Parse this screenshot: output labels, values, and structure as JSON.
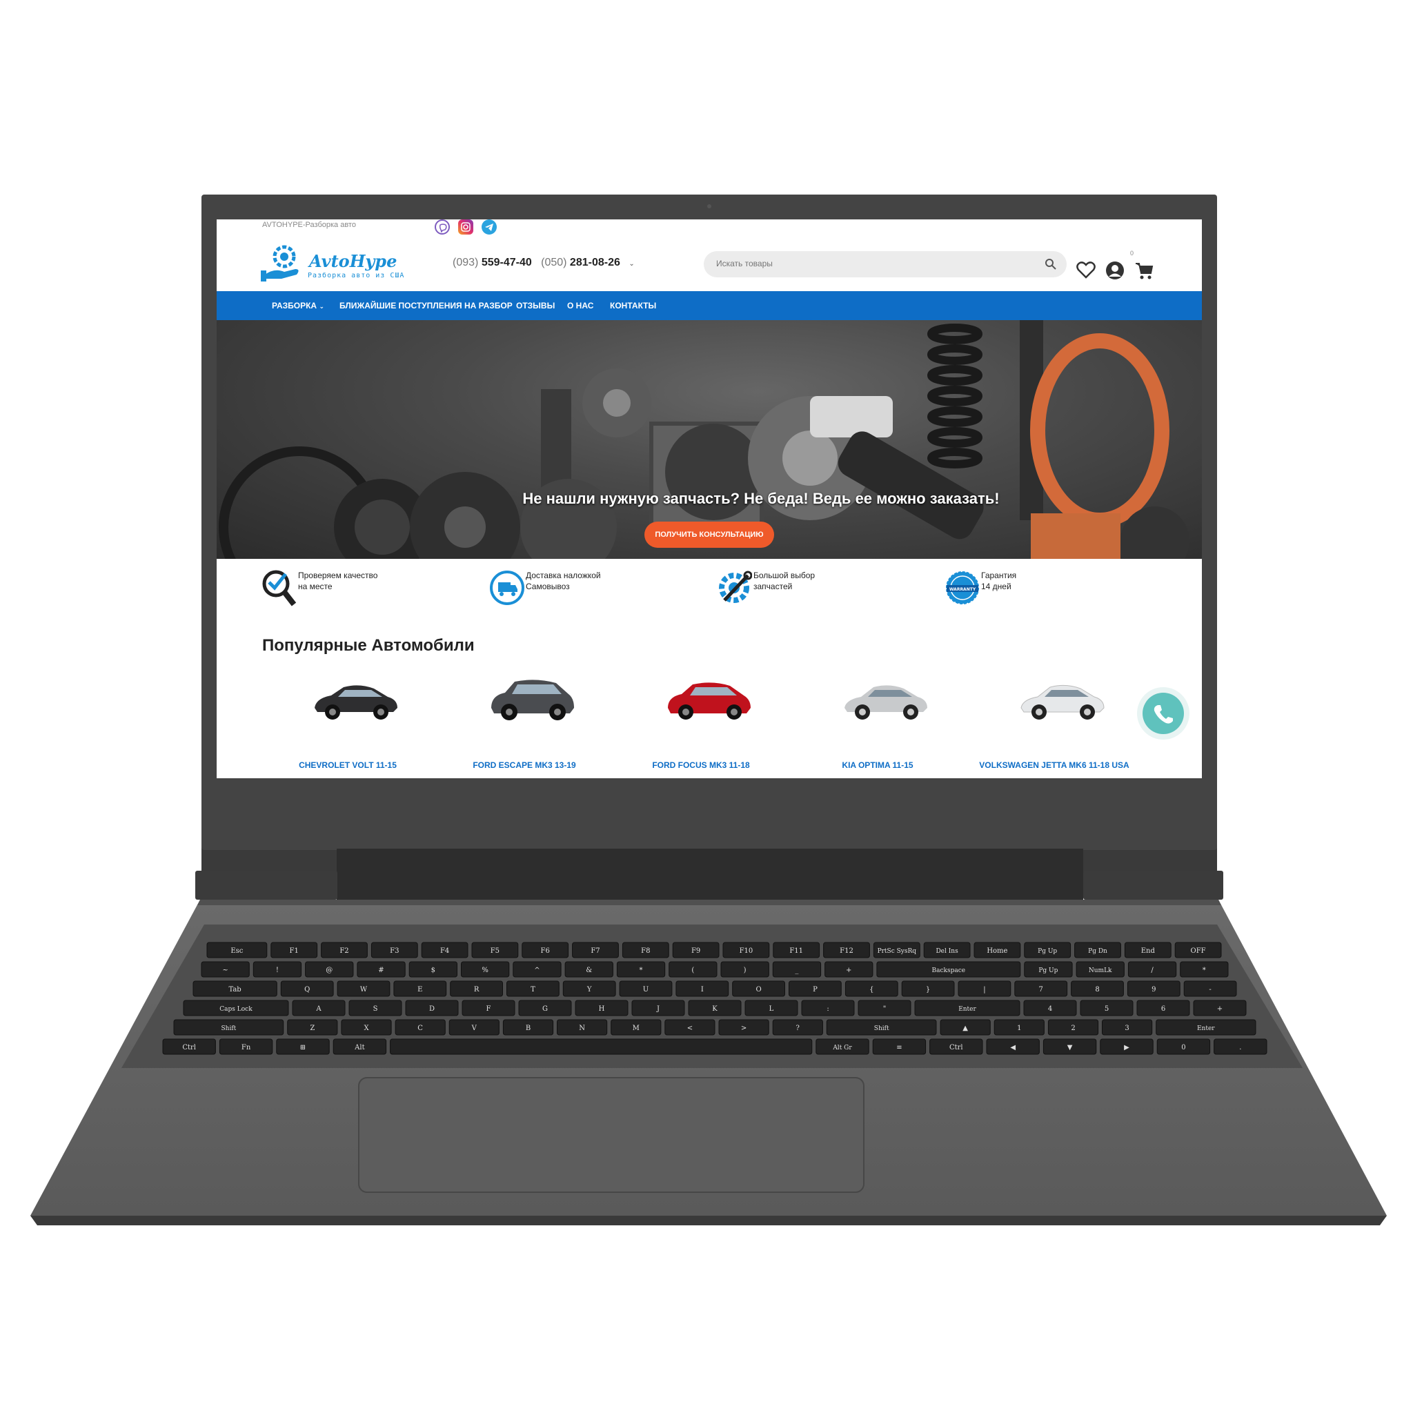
{
  "topbar": {
    "title": "AVTOHYPE-Разборка авто"
  },
  "header": {
    "logo_name": "AvtoHype",
    "logo_sub": "Разборка авто из США",
    "phone1_code": "(093)",
    "phone1_number": "559-47-40",
    "phone2_code": "(050)",
    "phone2_number": "281-08-26",
    "search_placeholder": "Искать товары",
    "cart_count": "0"
  },
  "nav": {
    "items": [
      {
        "label": "РАЗБОРКА"
      },
      {
        "label": "БЛИЖАЙШИЕ ПОСТУПЛЕНИЯ НА РАЗБОР"
      },
      {
        "label": "ОТЗЫВЫ"
      },
      {
        "label": "О НАС"
      },
      {
        "label": "КОНТАКТЫ"
      }
    ]
  },
  "hero": {
    "title": "Не нашли нужную запчасть? Не беда! Ведь ее можно заказать!",
    "button": "ПОЛУЧИТЬ КОНСУЛЬТАЦИЮ"
  },
  "features": [
    {
      "line1": "Проверяем качество",
      "line2": "на месте"
    },
    {
      "line1": "Доставка наложкой",
      "line2": "Самовывоз"
    },
    {
      "line1": "Большой выбор",
      "line2": "запчастей"
    },
    {
      "line1": "Гарантия",
      "line2": "14 дней",
      "badge": "WARRANTY"
    }
  ],
  "popular": {
    "title": "Популярные Автомобили",
    "cars": [
      {
        "label": "CHEVROLET VOLT 11-15",
        "color": "#2e2e30"
      },
      {
        "label": "FORD ESCAPE MK3 13-19",
        "color": "#4a4c50"
      },
      {
        "label": "FORD FOCUS MK3 11-18",
        "color": "#c0121d"
      },
      {
        "label": "KIA OPTIMA 11-15",
        "color": "#c8cacc"
      },
      {
        "label": "VOLKSWAGEN JETTA MK6 11-18 USA",
        "color": "#e6e8ea"
      }
    ]
  },
  "keyboard": {
    "rows": [
      [
        "Esc",
        "F1",
        "F2",
        "F3",
        "F4",
        "F5",
        "F6",
        "F7",
        "F8",
        "F9",
        "F10",
        "F11",
        "F12",
        "PrtSc SysRq",
        "Del Ins",
        "Home",
        "Pg Up",
        "Pg Dn",
        "End",
        "OFF"
      ],
      [
        "~",
        "!",
        "@",
        "#",
        "$",
        "%",
        "^",
        "&",
        "*",
        "(",
        ")",
        "_",
        "+",
        "Backspace",
        "Pg Up",
        "NumLk",
        "/",
        "*"
      ],
      [
        "Tab",
        "Q",
        "W",
        "E",
        "R",
        "T",
        "Y",
        "U",
        "I",
        "O",
        "P",
        "{",
        "}",
        "|",
        "7",
        "8",
        "9",
        "-"
      ],
      [
        "Caps Lock",
        "A",
        "S",
        "D",
        "F",
        "G",
        "H",
        "J",
        "K",
        "L",
        ":",
        "\"",
        "Enter",
        "4",
        "5",
        "6",
        "+"
      ],
      [
        "Shift",
        "Z",
        "X",
        "C",
        "V",
        "B",
        "N",
        "M",
        "<",
        ">",
        "?",
        "Shift",
        "▲",
        "1",
        "2",
        "3",
        "Enter"
      ],
      [
        "Ctrl",
        "Fn",
        "⊞",
        "Alt",
        "",
        "Alt Gr",
        "≡",
        "Ctrl",
        "◀",
        "▼",
        "▶",
        "0",
        "."
      ]
    ]
  },
  "colors": {
    "brand_blue": "#0e6dc6",
    "logo_blue": "#1a8fd6",
    "cta_orange": "#ef5a2a",
    "call_teal": "#5fc2bd"
  },
  "icons": [
    "viber-icon",
    "instagram-icon",
    "telegram-icon",
    "search-icon",
    "heart-icon",
    "user-icon",
    "cart-icon",
    "phone-icon"
  ]
}
